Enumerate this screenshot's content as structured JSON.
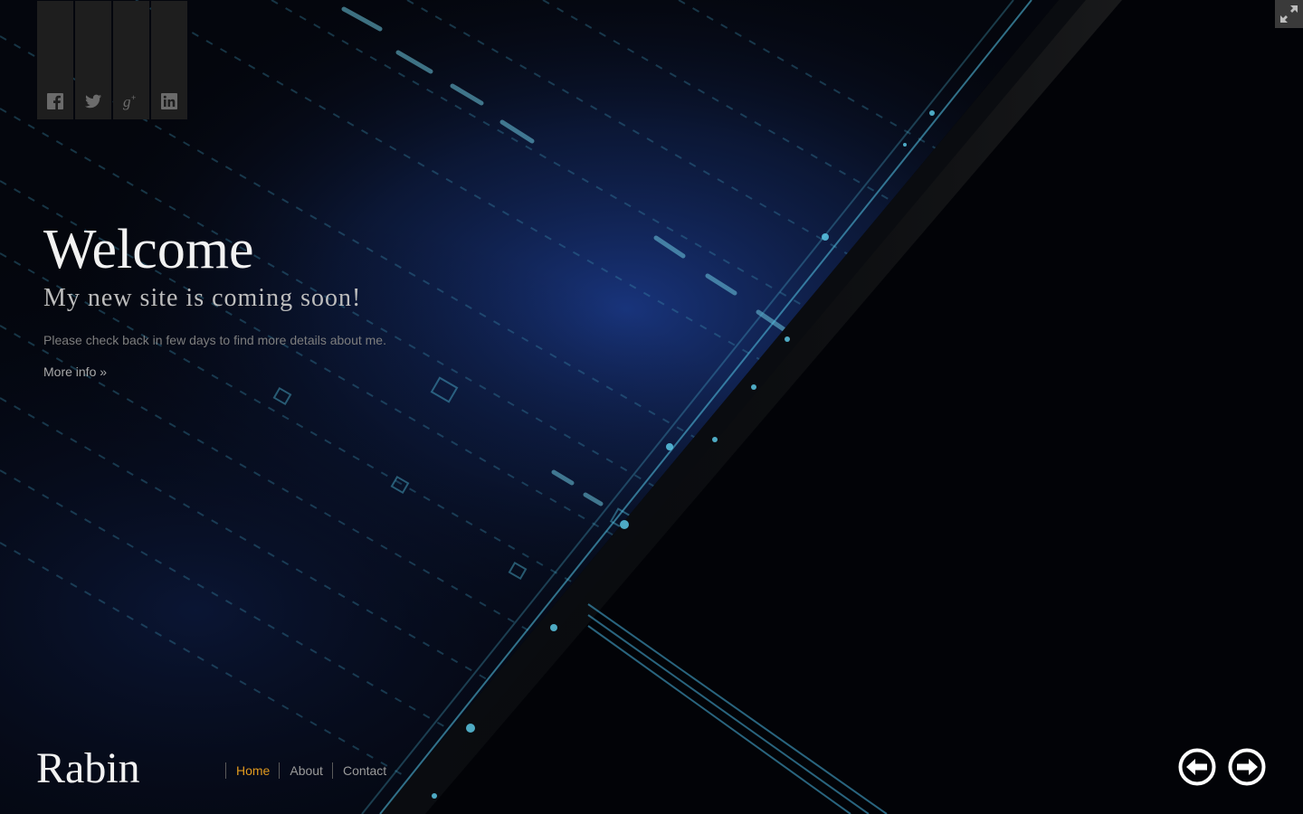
{
  "social": [
    {
      "name": "facebook",
      "icon": "facebook-icon"
    },
    {
      "name": "twitter",
      "icon": "twitter-icon"
    },
    {
      "name": "google-plus",
      "icon": "google-plus-icon"
    },
    {
      "name": "linkedin",
      "icon": "linkedin-icon"
    }
  ],
  "hero": {
    "title": "Welcome",
    "subtitle": "My new site is coming soon!",
    "text": "Please check back in few days to find more details about me.",
    "more_link": "More info »"
  },
  "footer": {
    "logo": "Rabin",
    "nav": [
      {
        "label": "Home",
        "active": true
      },
      {
        "label": "About",
        "active": false
      },
      {
        "label": "Contact",
        "active": false
      }
    ]
  },
  "icons": {
    "fullscreen": "fullscreen-toggle-icon",
    "prev": "arrow-left-circle-icon",
    "next": "arrow-right-circle-icon"
  },
  "colors": {
    "accent": "#e09a1e",
    "background": "#000000",
    "glow": "#1a3a8a"
  }
}
